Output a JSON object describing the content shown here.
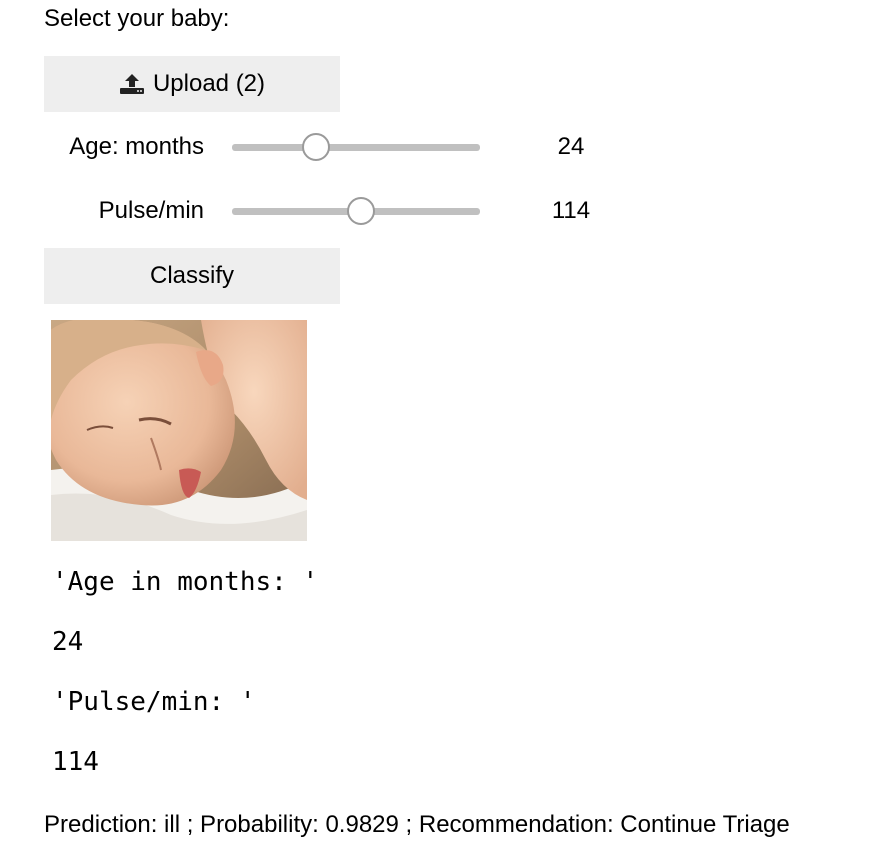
{
  "form": {
    "prompt": "Select your baby:",
    "upload_label": "Upload (2)",
    "upload_icon": "upload-icon",
    "classify_label": "Classify"
  },
  "sliders": {
    "age": {
      "label": "Age: months",
      "value": "24"
    },
    "pulse": {
      "label": "Pulse/min",
      "value": "114"
    }
  },
  "image": {
    "subject": "sleeping-baby-photo"
  },
  "output": {
    "age_label": "'Age in months: '",
    "age_value": "24",
    "pulse_label": "'Pulse/min: '",
    "pulse_value": "114",
    "prediction": "Prediction: ill ; Probability: 0.9829 ; Recommendation: Continue Triage"
  },
  "colors": {
    "button_bg": "#eeeeee",
    "track": "#c0c0c0",
    "thumb_border": "#9a9a9a"
  }
}
